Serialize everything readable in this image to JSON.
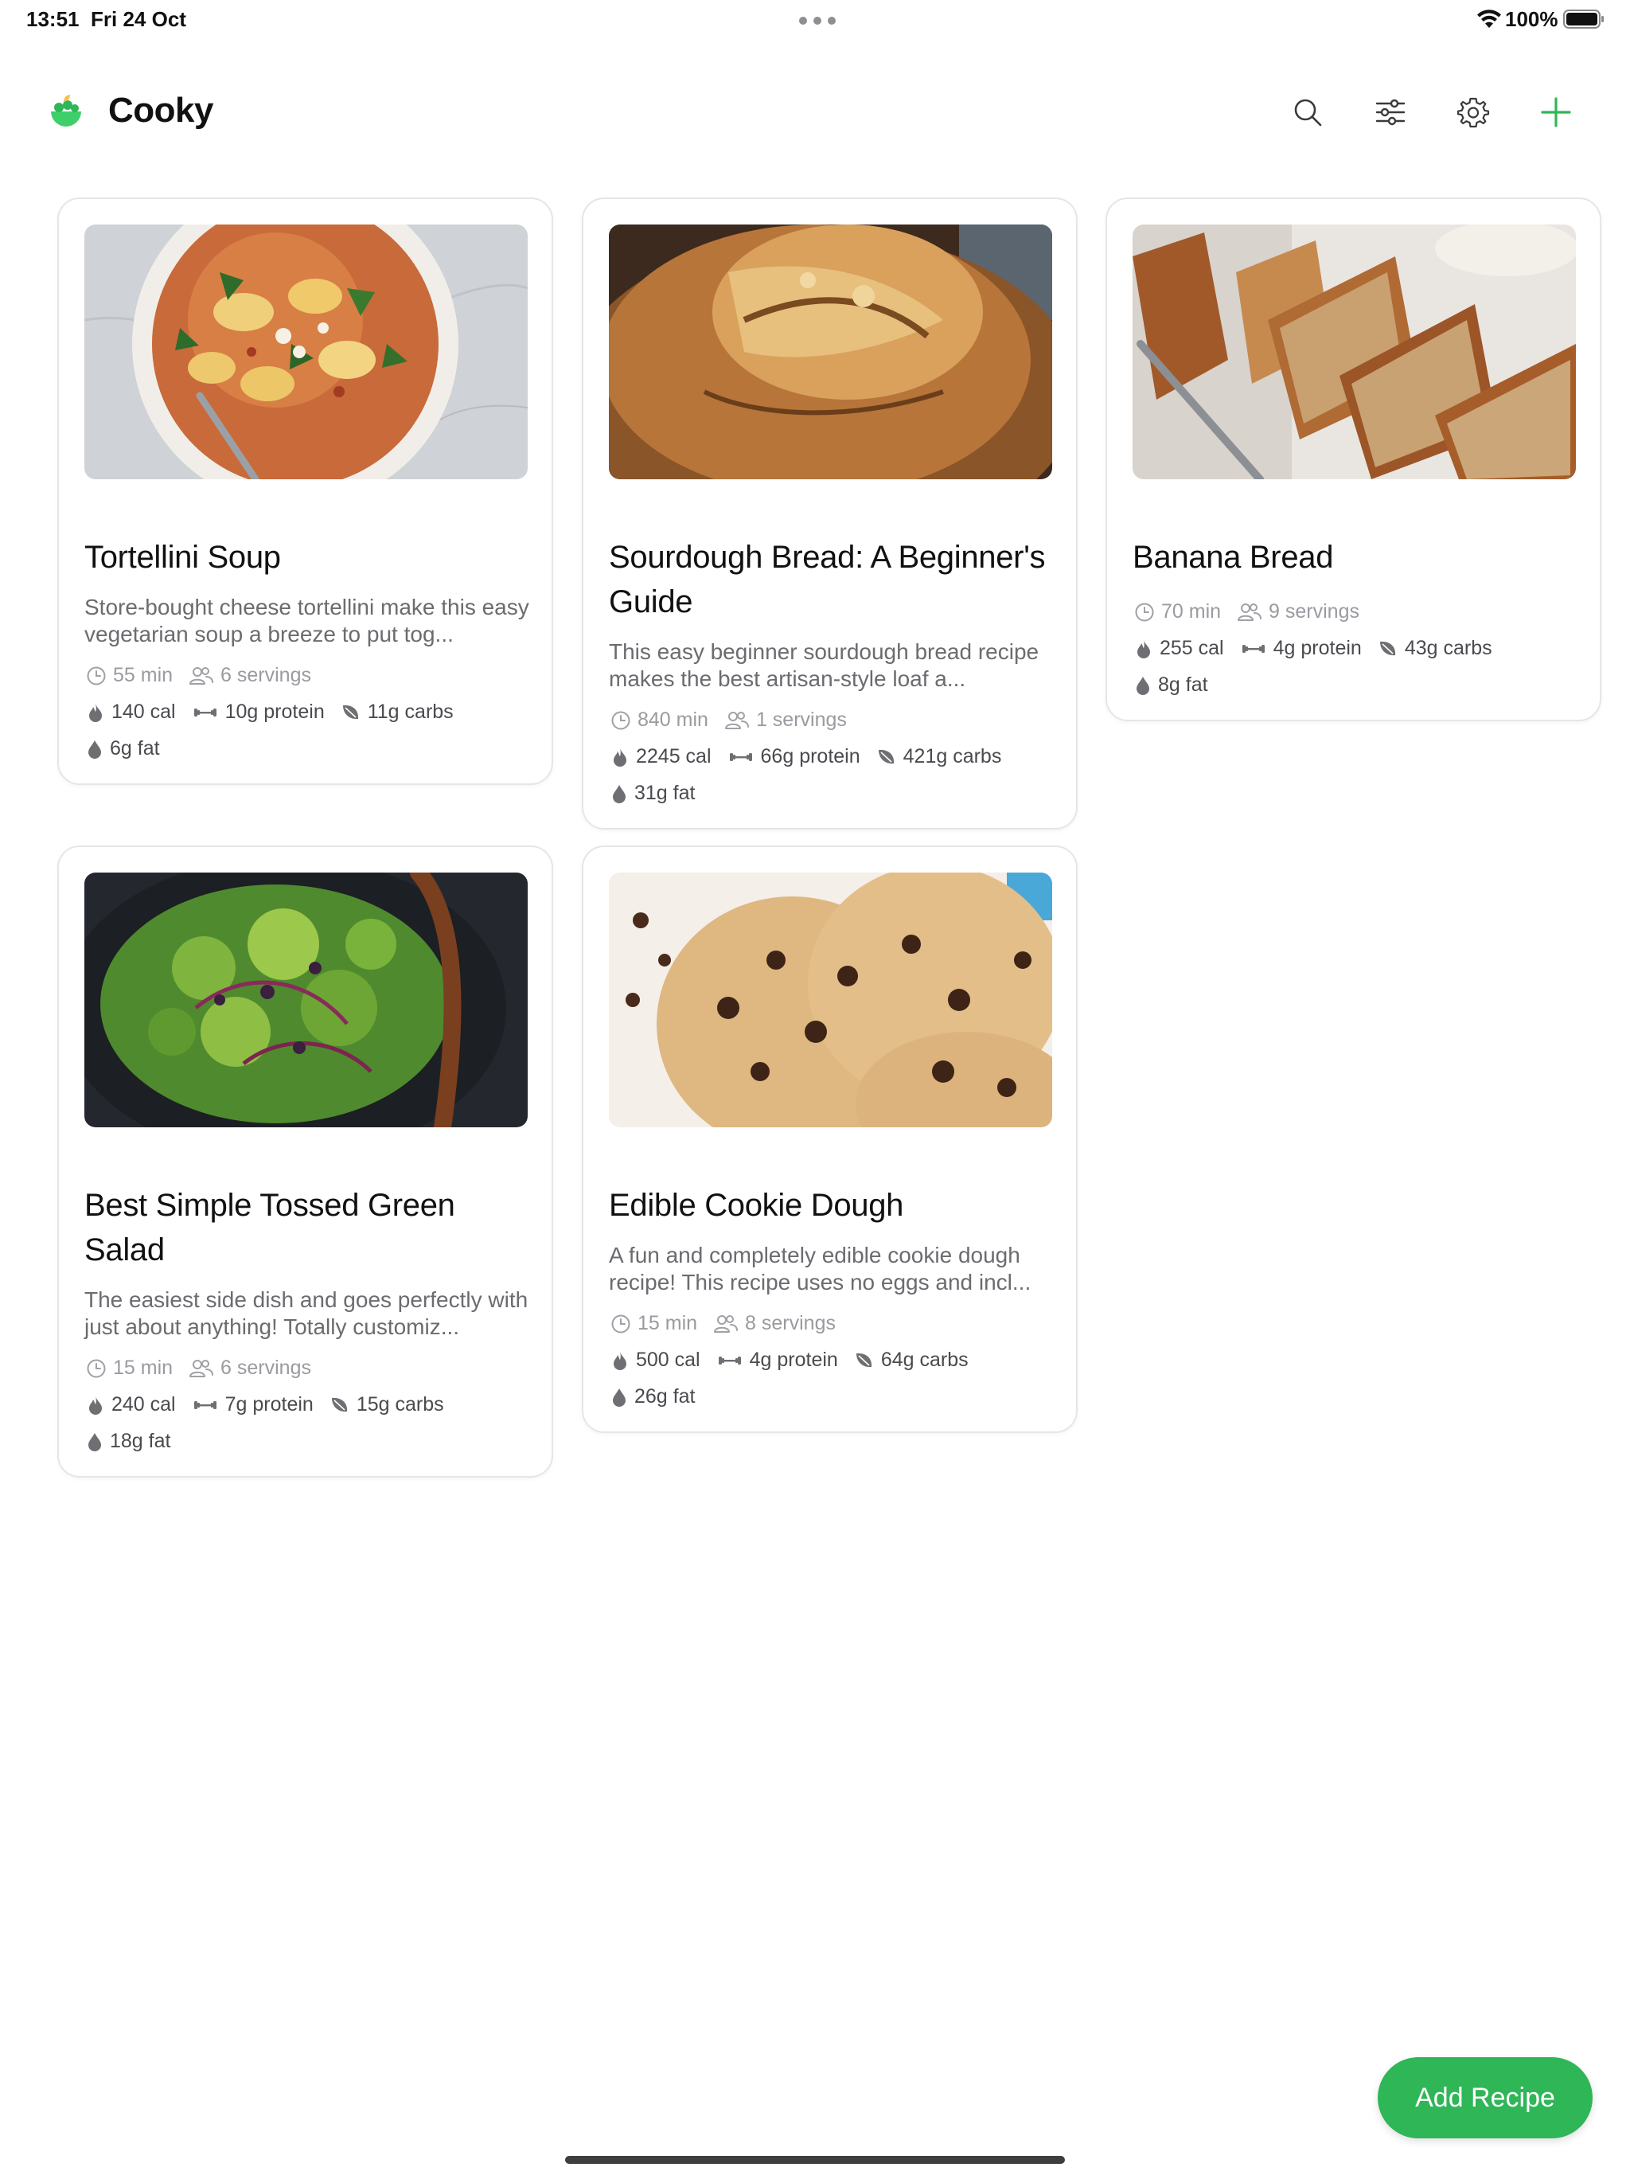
{
  "status_bar": {
    "time": "13:51",
    "date": "Fri 24 Oct",
    "battery": "100%"
  },
  "header": {
    "app_title": "Cooky",
    "accent_color": "#2fb657"
  },
  "recipes": [
    {
      "title": "Tortellini Soup",
      "description": "Store-bought cheese tortellini make this easy vegetarian soup a breeze to put tog...",
      "time": "55 min",
      "servings": "6 servings",
      "calories": "140 cal",
      "protein": "10g protein",
      "carbs": "11g carbs",
      "fat": "6g fat",
      "image": "tortellini-soup-photo"
    },
    {
      "title": "Sourdough Bread: A Beginner's Guide",
      "description": "This easy beginner sourdough bread recipe makes the best artisan-style loaf a...",
      "time": "840 min",
      "servings": "1 servings",
      "calories": "2245 cal",
      "protein": "66g protein",
      "carbs": "421g carbs",
      "fat": "31g fat",
      "image": "sourdough-bread-photo"
    },
    {
      "title": "Banana Bread",
      "description": "",
      "time": "70 min",
      "servings": "9 servings",
      "calories": "255 cal",
      "protein": "4g protein",
      "carbs": "43g carbs",
      "fat": "8g fat",
      "image": "banana-bread-photo"
    },
    {
      "title": "Best Simple Tossed Green Salad",
      "description": "The easiest side dish and goes perfectly with just about anything! Totally customiz...",
      "time": "15 min",
      "servings": "6 servings",
      "calories": "240 cal",
      "protein": "7g protein",
      "carbs": "15g carbs",
      "fat": "18g fat",
      "image": "green-salad-photo"
    },
    {
      "title": "Edible Cookie Dough",
      "description": "A fun and completely edible cookie dough recipe! This recipe uses no eggs and incl...",
      "time": "15 min",
      "servings": "8 servings",
      "calories": "500 cal",
      "protein": "4g protein",
      "carbs": "64g carbs",
      "fat": "26g fat",
      "image": "cookie-dough-photo"
    }
  ],
  "actions": {
    "add_recipe_label": "Add Recipe"
  }
}
